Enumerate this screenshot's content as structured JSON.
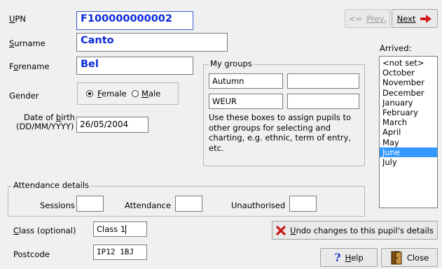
{
  "fields": {
    "upn": {
      "label": "UPN",
      "value": "F100000000002"
    },
    "surname": {
      "label": "Surname",
      "value": "Canto"
    },
    "forename": {
      "label": "Forename",
      "value": "Bel"
    },
    "gender": {
      "label": "Gender",
      "female": "Female",
      "male": "Male",
      "selected": "Female"
    },
    "dob": {
      "label_line1": "Date of birth",
      "label_line2": "(DD/MM/YYYY)",
      "value": "26/05/2004"
    },
    "class": {
      "label": "Class (optional)",
      "value": "Class 1"
    },
    "postcode": {
      "label": "Postcode",
      "value": "IP12 1BJ"
    }
  },
  "nav": {
    "prev": "Prev.",
    "next": "Next"
  },
  "groups": {
    "title": "My groups",
    "values": [
      "Autumn",
      "",
      "WEUR",
      ""
    ],
    "help": "Use these boxes to assign pupils to other groups for selecting and charting, e.g. ethnic, term of entry, etc."
  },
  "arrived": {
    "label": "Arrived:",
    "options": [
      "<not set>",
      "October",
      "November",
      "December",
      "January",
      "February",
      "March",
      "April",
      "May",
      "June",
      "July"
    ],
    "selected": "June"
  },
  "attendance": {
    "title": "Attendance details",
    "sessions": "Sessions",
    "attendance": "Attendance",
    "unauthorised": "Unauthorised",
    "sessions_value": "",
    "attendance_value": "",
    "unauthorised_value": ""
  },
  "buttons": {
    "undo": "Undo changes to this pupil's details",
    "help": "Help",
    "close": "Close"
  }
}
